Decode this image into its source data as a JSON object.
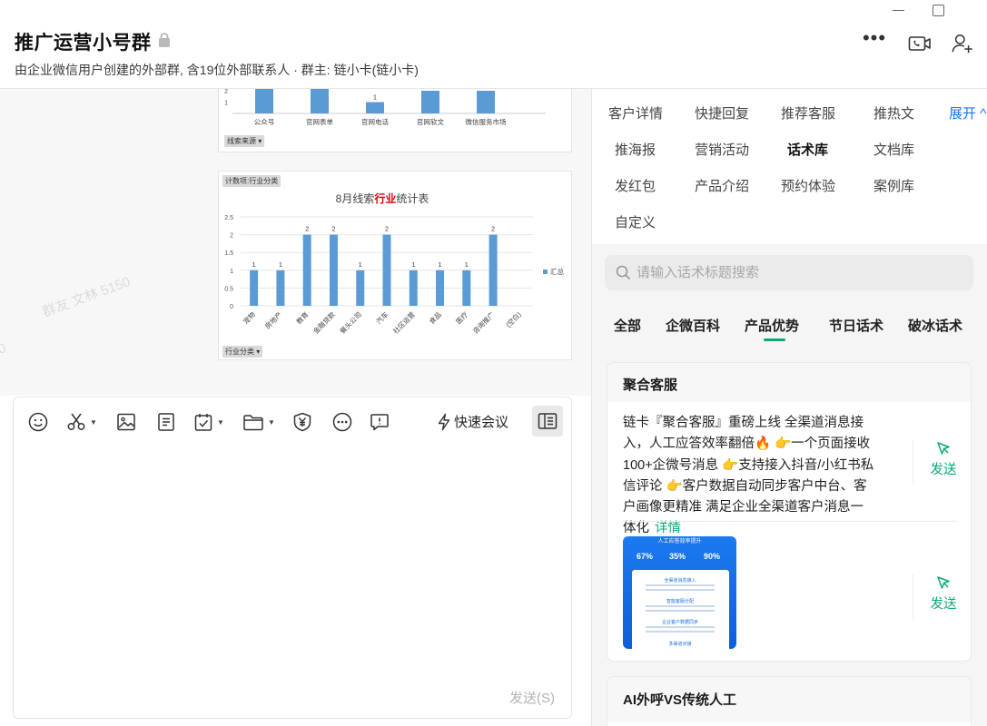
{
  "window": {
    "min_icon": "minimize-icon",
    "max_icon": "maximize-icon"
  },
  "header": {
    "title": "推广运营小号群",
    "subtitle": "由企业微信用户创建的外部群, 含19位外部联系人 · 群主: 链小卡(链小卡)",
    "more_label": "•••"
  },
  "chat": {
    "watermark": "群友 文林 5150",
    "watermark2": "0",
    "chart1": {
      "filter_label": "线索来源",
      "chart_data": {
        "type": "bar",
        "categories": [
          "公众号",
          "官网表单",
          "官网电话",
          "官网软文",
          "微信服务市场"
        ],
        "values": [
          3,
          3,
          1,
          2,
          2
        ],
        "ylim": [
          0,
          3
        ],
        "visible_ticks": [
          "2",
          "1"
        ],
        "color": "#5b9bd5"
      }
    },
    "chart2": {
      "field_label": "计数项:行业分类",
      "filter_label": "行业分类",
      "title_pre": "8月线索",
      "title_hl": "行业",
      "title_post": "统计表",
      "legend": "汇总",
      "chart_data": {
        "type": "bar",
        "title": "8月线索行业统计表",
        "categories": [
          "宠物",
          "房地产",
          "教育",
          "金融贷款",
          "餐头公司",
          "汽车",
          "社区运营",
          "食品",
          "医疗",
          "咨询推广",
          "(空白)"
        ],
        "values": [
          1,
          1,
          2,
          2,
          1,
          2,
          1,
          1,
          1,
          2,
          null
        ],
        "yticks": [
          "0",
          "0.5",
          "1",
          "1.5",
          "2",
          "2.5"
        ],
        "ylim": [
          0,
          2.5
        ],
        "series": [
          {
            "name": "汇总"
          }
        ],
        "legend_position": "right",
        "color": "#5b9bd5",
        "title_highlight_color": "#e0000b"
      }
    }
  },
  "composer": {
    "quick_meeting": "快速会议",
    "send": "发送(S)"
  },
  "right_tabs": [
    "客户详情",
    "快捷回复",
    "推荐客服",
    "推热文",
    "展开",
    "推海报",
    "营销活动",
    "话术库",
    "文档库",
    "发红包",
    "产品介绍",
    "预约体验",
    "案例库",
    "自定义"
  ],
  "active_tab": "话术库",
  "search": {
    "placeholder": "请输入话术标题搜索"
  },
  "categories": [
    "全部",
    "企微百科",
    "产品优势",
    "节日话术",
    "破冰话术"
  ],
  "active_category": "产品优势",
  "accent_color": "#0aa87a",
  "cards": [
    {
      "title": "聚合客服",
      "text": "链卡『聚合客服』重磅上线 全渠道消息接入，人工应答效率翻倍🔥 👉一个页面接收100+企微号消息 👉支持接入抖音/小红书私信评论 👉客户数据自动同步客户中台、客户画像更精准 满足企业全渠道客户消息一体化",
      "detail": "详情",
      "send": "发送",
      "image": {
        "banner": "人工应答效率提升",
        "stats": [
          "67%",
          "35%",
          "90%"
        ],
        "s1": "全渠道消息接入",
        "s2": "智能客服分配",
        "s3": "企业客户数据同步",
        "s4": "多渠道对接"
      }
    },
    {
      "title": "AI外呼VS传统人工"
    }
  ]
}
